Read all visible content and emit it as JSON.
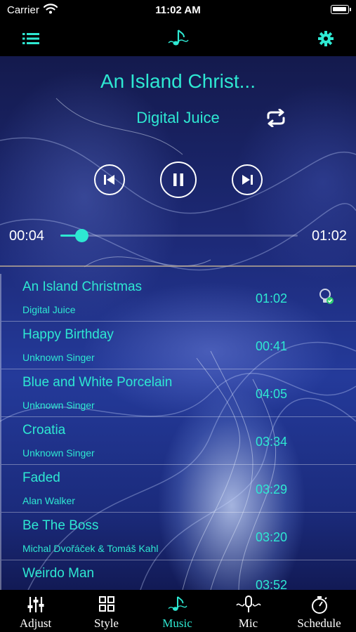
{
  "status_bar": {
    "carrier": "Carrier",
    "time": "11:02 AM"
  },
  "nav": {
    "left_icon": "list-icon",
    "center_icon": "music-note-icon",
    "right_icon": "gear-icon"
  },
  "colors": {
    "accent": "#2ee8d2",
    "background": "#000000"
  },
  "now_playing": {
    "title": "An Island Christ...",
    "artist": "Digital Juice",
    "elapsed": "00:04",
    "total": "01:02",
    "progress": 0.09
  },
  "playlist": [
    {
      "title": "An Island Christmas",
      "artist": "Digital Juice",
      "duration": "01:02",
      "playing": true
    },
    {
      "title": "Happy Birthday",
      "artist": "Unknown Singer",
      "duration": "00:41"
    },
    {
      "title": "Blue and White Porcelain",
      "artist": "Unknown Singer",
      "duration": "04:05"
    },
    {
      "title": "Croatia",
      "artist": "Unknown Singer",
      "duration": "03:34"
    },
    {
      "title": "Faded",
      "artist": "Alan Walker",
      "duration": "03:29"
    },
    {
      "title": "Be The Boss",
      "artist": "Michal Dvořáček & Tomáš Kahl",
      "duration": "03:20"
    },
    {
      "title": "Weirdo Man",
      "artist": "",
      "duration": "03:52"
    }
  ],
  "tabs": [
    {
      "label": "Adjust",
      "icon": "sliders-icon"
    },
    {
      "label": "Style",
      "icon": "grid-icon"
    },
    {
      "label": "Music",
      "icon": "music-note-icon",
      "active": true
    },
    {
      "label": "Mic",
      "icon": "microphone-icon"
    },
    {
      "label": "Schedule",
      "icon": "timer-icon"
    }
  ]
}
